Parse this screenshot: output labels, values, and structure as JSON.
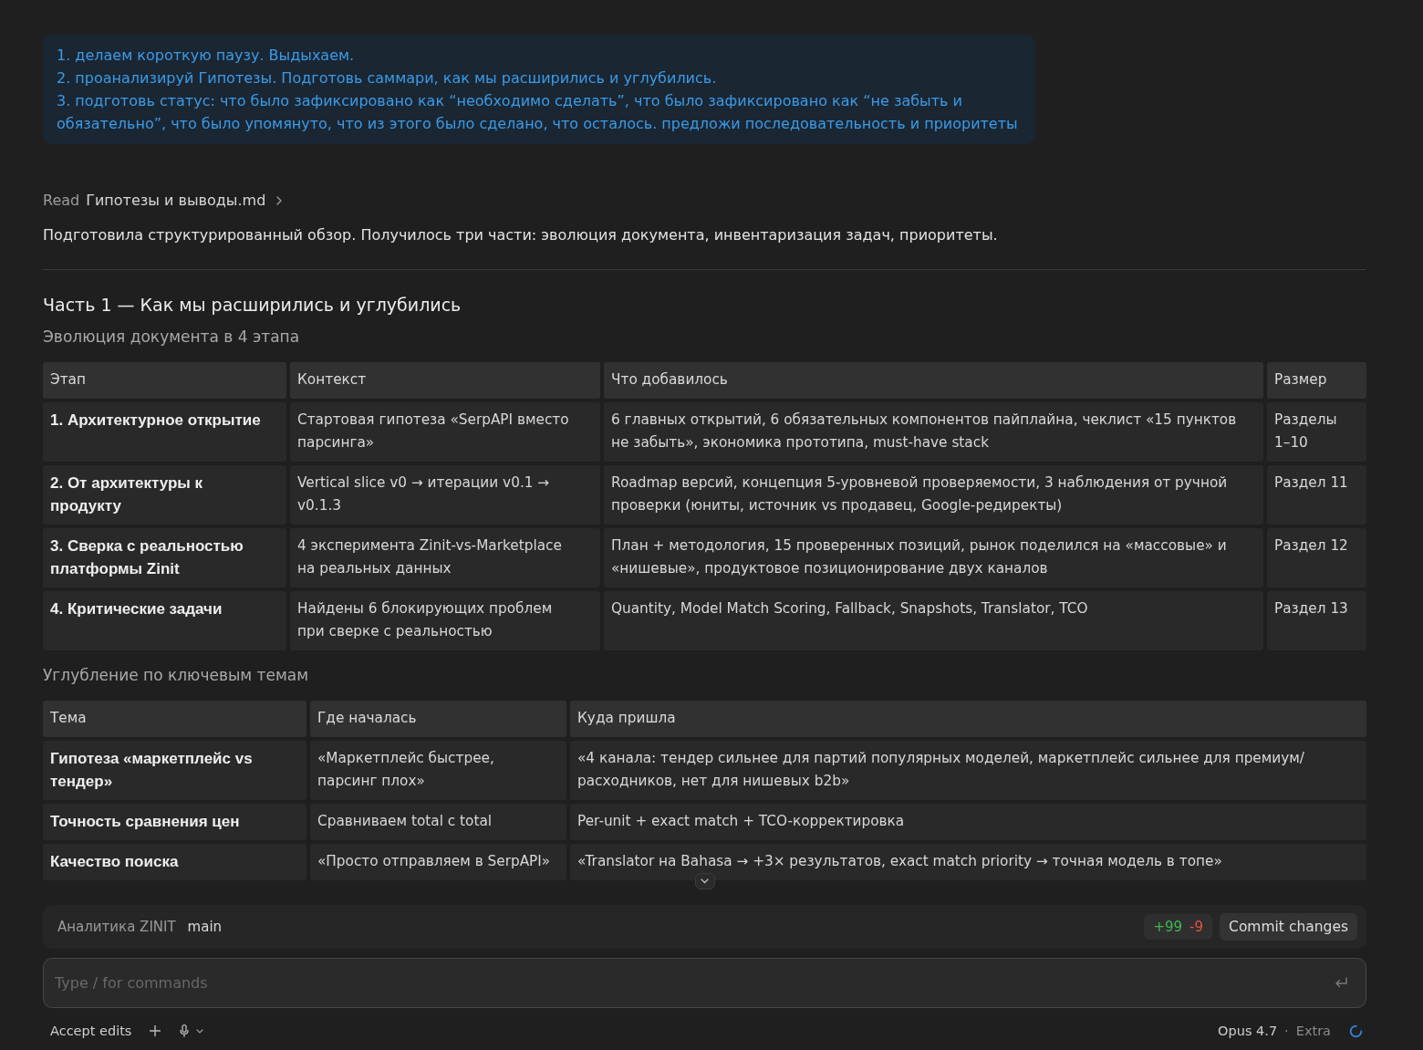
{
  "user_message": {
    "items": [
      "1. делаем короткую паузу. Выдыхаем.",
      "2. проанализируй Гипотезы. Подготовь саммари, как мы расширились и углубились.",
      "3. подготовь статус: что было зафиксировано как “необходимо сделать”, что было зафиксировано как “не забыть и обязательно”, что было упомянуто, что из этого было сделано, что осталось. предложи последовательность и приоритеты"
    ]
  },
  "tool_call": {
    "verb": "Read",
    "target": "Гипотезы и выводы.md",
    "expanded": false
  },
  "summary": "Подготовила структурированный обзор. Получилось три части: эволюция документа, инвентаризация задач, приоритеты.",
  "section_title": "Часть 1 — Как мы расширились и углубились",
  "tables": [
    {
      "caption": "Эволюция документа в 4 этапа",
      "columns": [
        "Этап",
        "Контекст",
        "Что добавилось",
        "Размер"
      ],
      "rows": [
        [
          "1. Архитектурное открытие",
          "Стартовая гипотеза «SerpAPI вместо парсинга»",
          "6 главных открытий, 6 обязательных компонентов пайплайна, чеклист «15 пунктов не забыть», экономика прототипа, must-have stack",
          "Разделы 1–10"
        ],
        [
          "2. От архитектуры к продукту",
          "Vertical slice v0 → итерации v0.1 → v0.1.3",
          "Roadmap версий, концепция 5-уровневой проверяемости, 3 наблюдения от ручной проверки (юниты, источник vs продавец, Google-редиректы)",
          "Раздел 11"
        ],
        [
          "3. Сверка с реальностью платформы Zinit",
          "4 эксперимента Zinit-vs-Marketplace на реальных данных",
          "План + методология, 15 проверенных позиций, рынок поделился на «массовые» и «нишевые», продуктовое позиционирование двух каналов",
          "Раздел 12"
        ],
        [
          "4. Критические задачи",
          "Найдены 6 блокирующих проблем при сверке с реальностью",
          "Quantity, Model Match Scoring, Fallback, Snapshots, Translator, TCO",
          "Раздел 13"
        ]
      ]
    },
    {
      "caption": "Углубление по ключевым темам",
      "columns": [
        "Тема",
        "Где началась",
        "Куда пришла"
      ],
      "rows": [
        [
          "Гипотеза «маркетплейс vs тендер»",
          "«Маркетплейс быстрее, парсинг плох»",
          "«4 канала: тендер сильнее для партий популярных моделей, маркетплейс сильнее для премиум/расходников, нет для нишевых b2b»"
        ],
        [
          "Точность сравнения цен",
          "Сравниваем total с total",
          "Per-unit + exact match + TCO-корректировка"
        ],
        [
          "Качество поиска",
          "«Просто отправляем в SerpAPI»",
          "«Translator на Bahasa → +3× результатов, exact match priority → точная модель в топе»"
        ]
      ]
    }
  ],
  "composer": {
    "project": "Аналитика ZINIT",
    "branch": "main",
    "diff": {
      "added": "+99",
      "removed": "-9"
    },
    "commit_button": "Commit changes",
    "input": {
      "placeholder": "Type / for commands"
    },
    "mode_button": "Accept edits",
    "model": "Opus 4.7",
    "separator": "·",
    "effort": "Extra"
  }
}
